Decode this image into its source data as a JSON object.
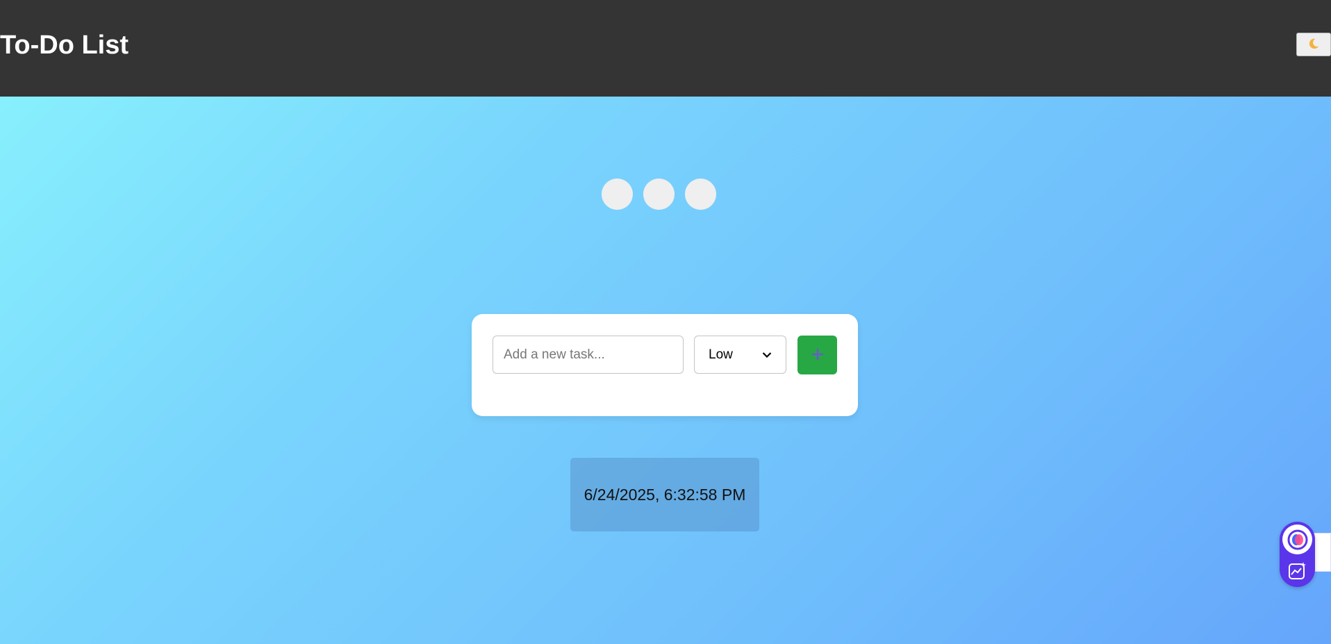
{
  "header": {
    "title": "To-Do List",
    "theme_toggle_icon": "crescent-moon-icon",
    "background": "#343434"
  },
  "loading_dots": {
    "count": 3,
    "color": "#efefef"
  },
  "task_form": {
    "input_placeholder": "Add a new task...",
    "input_value": "",
    "priority_selected": "Low",
    "add_button_icon": "plus-icon",
    "add_button_color": "#28a745"
  },
  "datetime": {
    "text": "6/24/2025, 6:32:58 PM"
  },
  "assistant_widget": {
    "logo_icon": "assistant-logo-icon",
    "chart_icon": "sparkle-chart-icon",
    "color": "#5b35ea"
  }
}
